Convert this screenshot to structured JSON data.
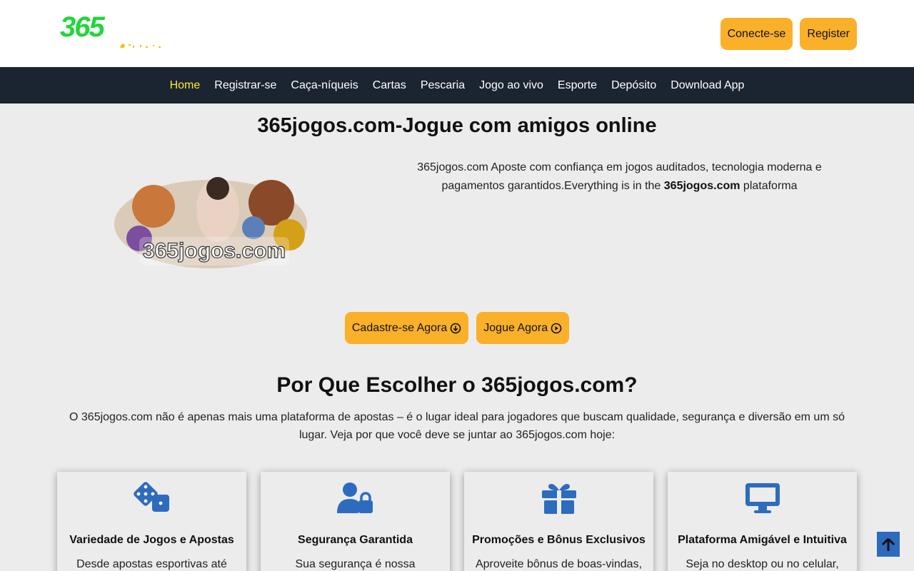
{
  "header": {
    "logo_text": "365",
    "login_label": "Conecte-se",
    "register_label": "Register"
  },
  "nav": {
    "items": [
      {
        "label": "Home"
      },
      {
        "label": "Registrar-se"
      },
      {
        "label": "Caça-níqueis"
      },
      {
        "label": "Cartas"
      },
      {
        "label": "Pescaria"
      },
      {
        "label": "Jogo ao vivo"
      },
      {
        "label": "Esporte"
      },
      {
        "label": "Depósito"
      },
      {
        "label": "Download App"
      }
    ],
    "active": "Home"
  },
  "hero": {
    "title": "365jogos.com-Jogue com amigos online",
    "image_text": "365jogos.com",
    "text_part1": "365jogos.com Aposte com confiança em jogos auditados, tecnologia moderna e pagamentos garantidos.Everything is in the ",
    "text_bold": "365jogos.com",
    "text_part2": " plataforma"
  },
  "cta": {
    "signup_label": "Cadastre-se Agora",
    "play_label": "Jogue Agora"
  },
  "why": {
    "title": "Por Que Escolher o 365jogos.com?",
    "text": "O 365jogos.com não é apenas mais uma plataforma de apostas – é o lugar ideal para jogadores que buscam qualidade, segurança e diversão em um só lugar. Veja por que você deve se juntar ao 365jogos.com hoje:"
  },
  "cards": [
    {
      "icon": "dice-icon",
      "title": "Variedade de Jogos e Apostas",
      "text": "Desde apostas esportivas até"
    },
    {
      "icon": "user-lock-icon",
      "title": "Segurança Garantida",
      "text": "Sua segurança é nossa"
    },
    {
      "icon": "gift-icon",
      "title": "Promoções e Bônus Exclusivos",
      "text": "Aproveite bônus de boas-vindas,"
    },
    {
      "icon": "desktop-icon",
      "title": "Plataforma Amigável e Intuitiva",
      "text": "Seja no desktop ou no celular,"
    }
  ],
  "colors": {
    "accent": "#fbb02a",
    "nav_bg": "#1b2431",
    "nav_active": "#ffe93a",
    "logo_green": "#22d63b",
    "icon_blue": "#2d6bbf"
  }
}
